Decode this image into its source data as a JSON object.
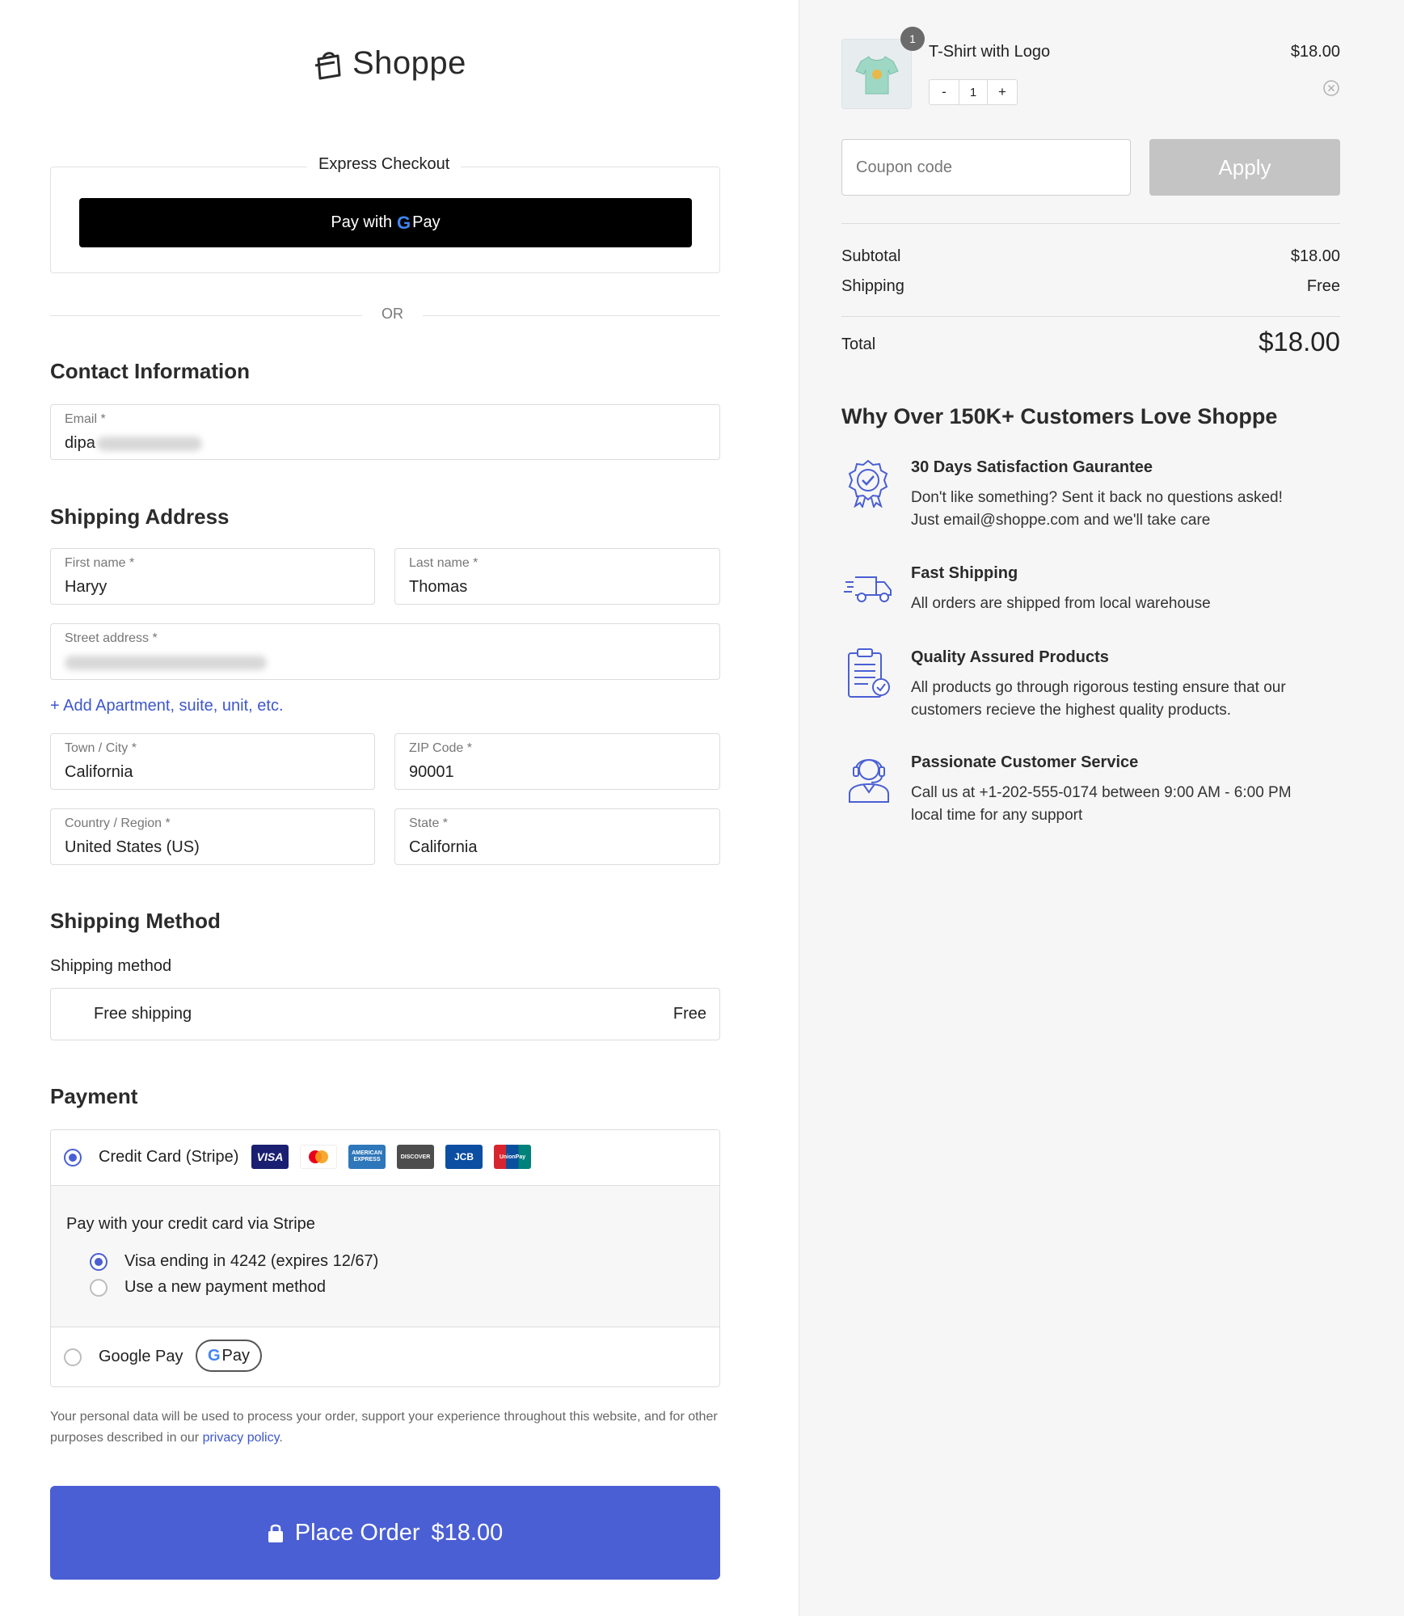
{
  "brand": {
    "name": "Shoppe"
  },
  "express": {
    "title": "Express Checkout",
    "button_prefix": "Pay with",
    "button_g": "G",
    "button_pay": "Pay",
    "or": "OR"
  },
  "contact": {
    "title": "Contact Information",
    "email_label": "Email *",
    "email_value": "dipa"
  },
  "shipping_address": {
    "title": "Shipping Address",
    "first_name_label": "First name *",
    "first_name_value": "Haryy",
    "last_name_label": "Last name *",
    "last_name_value": "Thomas",
    "street_label": "Street address *",
    "add_apartment": "Add Apartment, suite, unit, etc.",
    "city_label": "Town / City *",
    "city_value": "California",
    "zip_label": "ZIP Code *",
    "zip_value": "90001",
    "country_label": "Country / Region *",
    "country_value": "United States (US)",
    "state_label": "State *",
    "state_value": "California"
  },
  "shipping_method": {
    "title": "Shipping Method",
    "label": "Shipping method",
    "option_name": "Free shipping",
    "option_price": "Free"
  },
  "payment": {
    "title": "Payment",
    "stripe_label": "Credit Card (Stripe)",
    "card_brands": [
      "VISA",
      "mastercard",
      "AMERICAN EXPRESS",
      "DISCOVER",
      "JCB",
      "UnionPay"
    ],
    "stripe_desc": "Pay with your credit card via Stripe",
    "saved_card": "Visa ending in 4242 (expires 12/67)",
    "new_method": "Use a new payment method",
    "gpay_label": "Google Pay",
    "gpay_badge_g": "G",
    "gpay_badge_pay": "Pay"
  },
  "privacy": {
    "text": "Your personal data will be used to process your order, support your experience throughout this website, and for other purposes described in our ",
    "link": "privacy policy",
    "end": "."
  },
  "place_order": {
    "label": "Place Order",
    "amount": "$18.00"
  },
  "cart": {
    "item_name": "T-Shirt with Logo",
    "item_price": "$18.00",
    "badge_count": "1",
    "qty": "1",
    "qty_minus": "-",
    "qty_plus": "+",
    "coupon_placeholder": "Coupon code",
    "apply_label": "Apply",
    "subtotal_label": "Subtotal",
    "subtotal_value": "$18.00",
    "shipping_label": "Shipping",
    "shipping_value": "Free",
    "total_label": "Total",
    "total_value": "$18.00"
  },
  "why": {
    "title": "Why Over 150K+ Customers Love Shoppe",
    "features": [
      {
        "title": "30 Days Satisfaction Gaurantee",
        "line1": "Don't like something? Sent it back no questions asked!",
        "line2": "Just email@shoppe.com and we'll take care",
        "icon": "badge-check-icon"
      },
      {
        "title": "Fast Shipping",
        "line1": "All orders are shipped from local warehouse",
        "line2": "",
        "icon": "truck-icon"
      },
      {
        "title": "Quality Assured Products",
        "line1": "All products go through rigorous testing ensure that our",
        "line2": "customers recieve the highest quality products.",
        "icon": "clipboard-check-icon"
      },
      {
        "title": "Passionate Customer Service",
        "line1": "Call us at +1-202-555-0174 between 9:00 AM - 6:00 PM",
        "line2": "local time for any support",
        "icon": "headset-agent-icon"
      }
    ]
  },
  "colors": {
    "accent": "#4a5fd4",
    "link": "#3e57cc",
    "right_bg": "#f6f6f6",
    "icon": "#4a5fd4"
  }
}
